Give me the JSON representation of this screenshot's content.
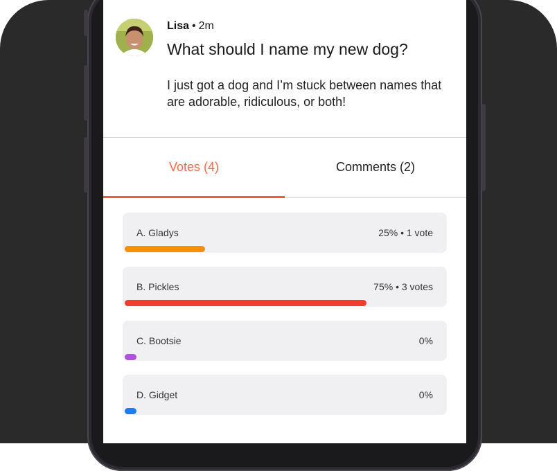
{
  "post": {
    "author": "Lisa",
    "separator": "•",
    "time": "2m",
    "title": "What should I name my new dog?",
    "body": "I just got a dog and I’m stuck between names that are adorable, ridiculous, or both!"
  },
  "tabs": [
    {
      "label": "Votes (4)",
      "active": true
    },
    {
      "label": "Comments (2)",
      "active": false
    }
  ],
  "options": [
    {
      "label": "A. Gladys",
      "stats": "25%  •  1 vote",
      "percent": 25,
      "color": "#f5900a"
    },
    {
      "label": "B. Pickles",
      "stats": "75%  •  3 votes",
      "percent": 75,
      "color": "#f23c2e"
    },
    {
      "label": "C. Bootsie",
      "stats": "0%",
      "percent": 0,
      "color": "#b052e0"
    },
    {
      "label": "D. Gidget",
      "stats": "0%",
      "percent": 0,
      "color": "#1a7df0"
    }
  ],
  "colors": {
    "accent": "#f26b4a",
    "tab_indicator": "#f25a3c"
  }
}
